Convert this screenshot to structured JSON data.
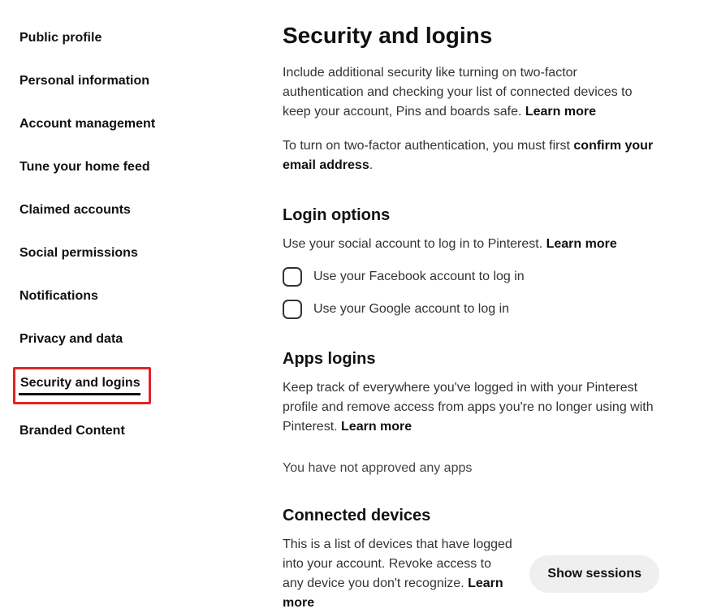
{
  "sidebar": {
    "items": [
      {
        "label": "Public profile"
      },
      {
        "label": "Personal information"
      },
      {
        "label": "Account management"
      },
      {
        "label": "Tune your home feed"
      },
      {
        "label": "Claimed accounts"
      },
      {
        "label": "Social permissions"
      },
      {
        "label": "Notifications"
      },
      {
        "label": "Privacy and data"
      },
      {
        "label": "Security and logins"
      },
      {
        "label": "Branded Content"
      }
    ]
  },
  "main": {
    "title": "Security and logins",
    "intro_text": "Include additional security like turning on two-factor authentication and checking your list of connected devices to keep your account, Pins and boards safe. ",
    "learn_more": "Learn more",
    "twofa_prefix": "To turn on two-factor authentication, you must first ",
    "twofa_action": "confirm your email address",
    "twofa_suffix": ".",
    "login_options": {
      "heading": "Login options",
      "desc_text": "Use your social account to log in to Pinterest. ",
      "facebook_label": "Use your Facebook account to log in",
      "google_label": "Use your Google account to log in"
    },
    "apps_logins": {
      "heading": "Apps logins",
      "desc_text": "Keep track of everywhere you've logged in with your Pinterest profile and remove access from apps you're no longer using with Pinterest. ",
      "empty_state": "You have not approved any apps"
    },
    "connected_devices": {
      "heading": "Connected devices",
      "desc_text": "This is a list of devices that have logged into your account. Revoke access to any device you don't recognize. ",
      "button_label": "Show sessions"
    }
  }
}
